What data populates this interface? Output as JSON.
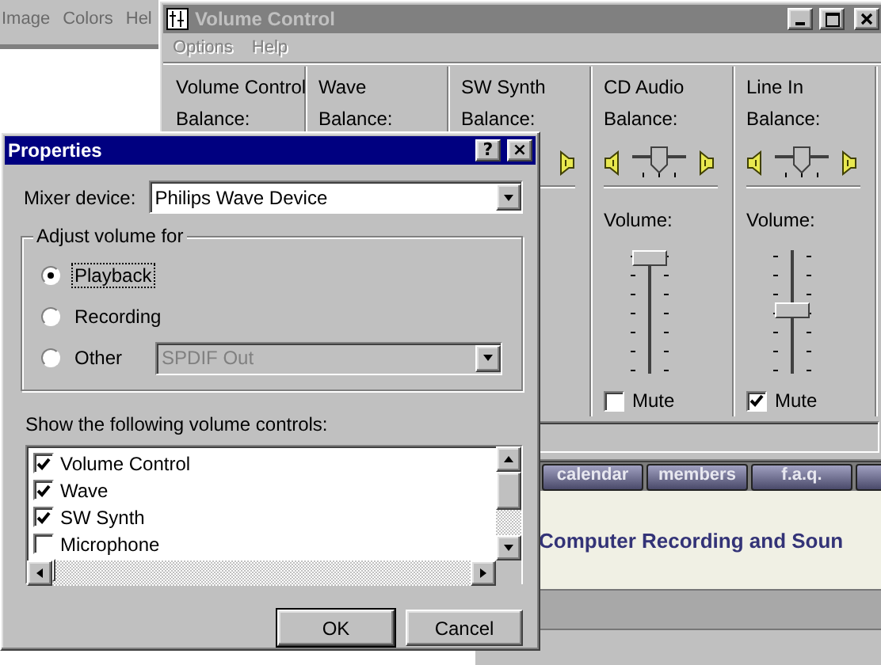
{
  "background_window": {
    "menu": [
      "Image",
      "Colors",
      "Hel"
    ]
  },
  "web_page": {
    "tabs": [
      "calendar",
      "members",
      "f.a.q."
    ],
    "headline": "Computer Recording and Soun"
  },
  "volume_window": {
    "title": "Volume Control",
    "menu": [
      "Options",
      "Help"
    ],
    "columns": [
      {
        "kind": "covered",
        "name": "Volume Control",
        "balance_label": "Balance:"
      },
      {
        "kind": "covered",
        "name": "Wave",
        "balance_label": "Balance:"
      },
      {
        "kind": "edge",
        "name": "SW Synth",
        "balance_label": "Balance:"
      },
      {
        "kind": "full",
        "name": "CD Audio",
        "balance_label": "Balance:",
        "balance_slider": {
          "level": 0.5
        },
        "volume_label": "Volume:",
        "volume_slider": {
          "level": 0.97
        },
        "mute_label": "Mute",
        "muted": false
      },
      {
        "kind": "full",
        "name": "Line In",
        "balance_label": "Balance:",
        "balance_slider": {
          "level": 0.5
        },
        "volume_label": "Volume:",
        "volume_slider": {
          "level": 0.52
        },
        "mute_label": "Mute",
        "muted": true
      }
    ]
  },
  "properties_dialog": {
    "title": "Properties",
    "help_button": "?",
    "close_button": "×",
    "mixer_label": "Mixer device:",
    "mixer_value": "Philips Wave Device",
    "group_label": "Adjust volume for",
    "options": [
      {
        "label": "Playback",
        "selected": true
      },
      {
        "label": "Recording",
        "selected": false
      },
      {
        "label": "Other",
        "selected": false,
        "device": "SPDIF Out",
        "disabled": true
      }
    ],
    "list_label": "Show the following volume controls:",
    "controls": [
      {
        "label": "Volume Control",
        "checked": true
      },
      {
        "label": "Wave",
        "checked": true
      },
      {
        "label": "SW Synth",
        "checked": true
      },
      {
        "label": "Microphone",
        "checked": false
      }
    ],
    "buttons": [
      "OK",
      "Cancel"
    ]
  }
}
